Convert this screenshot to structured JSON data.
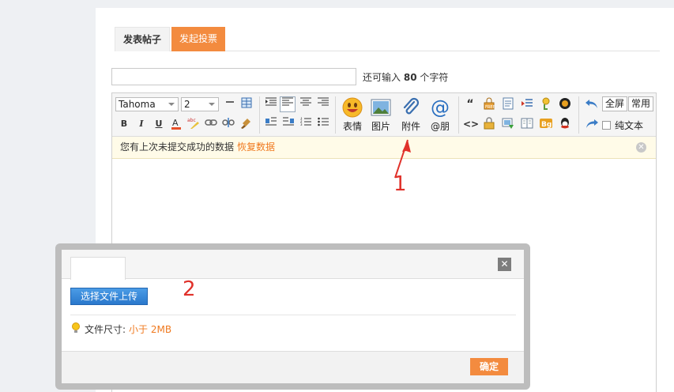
{
  "tabs": [
    {
      "label": "发表帖子"
    },
    {
      "label": "发起投票"
    }
  ],
  "subject": {
    "value": "",
    "char_hint_prefix": "还可输入",
    "char_count": "80",
    "char_hint_suffix": "个字符"
  },
  "toolbar": {
    "font_family": "Tahoma",
    "font_size": "2",
    "format_buttons": [
      "B",
      "I",
      "U"
    ],
    "emoji_label": "表情",
    "image_label": "图片",
    "attachment_label": "附件",
    "mention_label": "@朋",
    "fullscreen_label": "全屏",
    "common_label": "常用",
    "plain_text_label": "纯文本"
  },
  "notice": {
    "text": "您有上次未提交成功的数据",
    "restore_label": "恢复数据"
  },
  "dialog": {
    "upload_label": "选择文件上传",
    "size_label": "文件尺寸:",
    "size_limit": "小于 2MB",
    "ok_label": "确定"
  },
  "annotations": {
    "step1": "1",
    "step2": "2",
    "color": "#e0312a"
  },
  "colors": {
    "accent": "#f38b3f",
    "link": "#f07a20",
    "upload_button": "#2a78cc"
  }
}
